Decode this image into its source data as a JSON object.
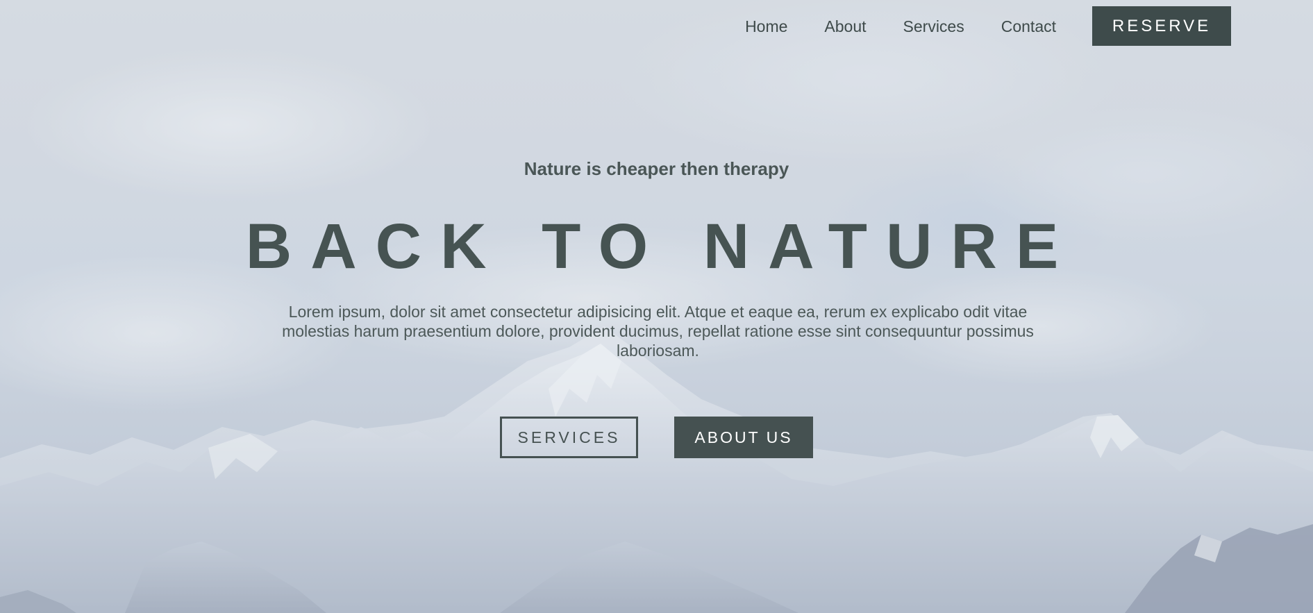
{
  "nav": {
    "links": [
      "Home",
      "About",
      "Services",
      "Contact"
    ],
    "reserve_label": "RESERVE"
  },
  "hero": {
    "tagline": "Nature is cheaper then therapy",
    "headline": "BACK TO NATURE",
    "description": "Lorem ipsum, dolor sit amet consectetur adipisicing elit. Atque et eaque ea, rerum ex explicabo odit vitae molestias harum praesentium dolore, provident ducimus, repellat ratione esse sint consequuntur possimus laboriosam.",
    "services_button": "SERVICES",
    "about_button": "ABOUT US"
  },
  "colors": {
    "text_dark": "#465352",
    "button_bg": "#3e4b4b",
    "button_text": "#ffffff"
  }
}
